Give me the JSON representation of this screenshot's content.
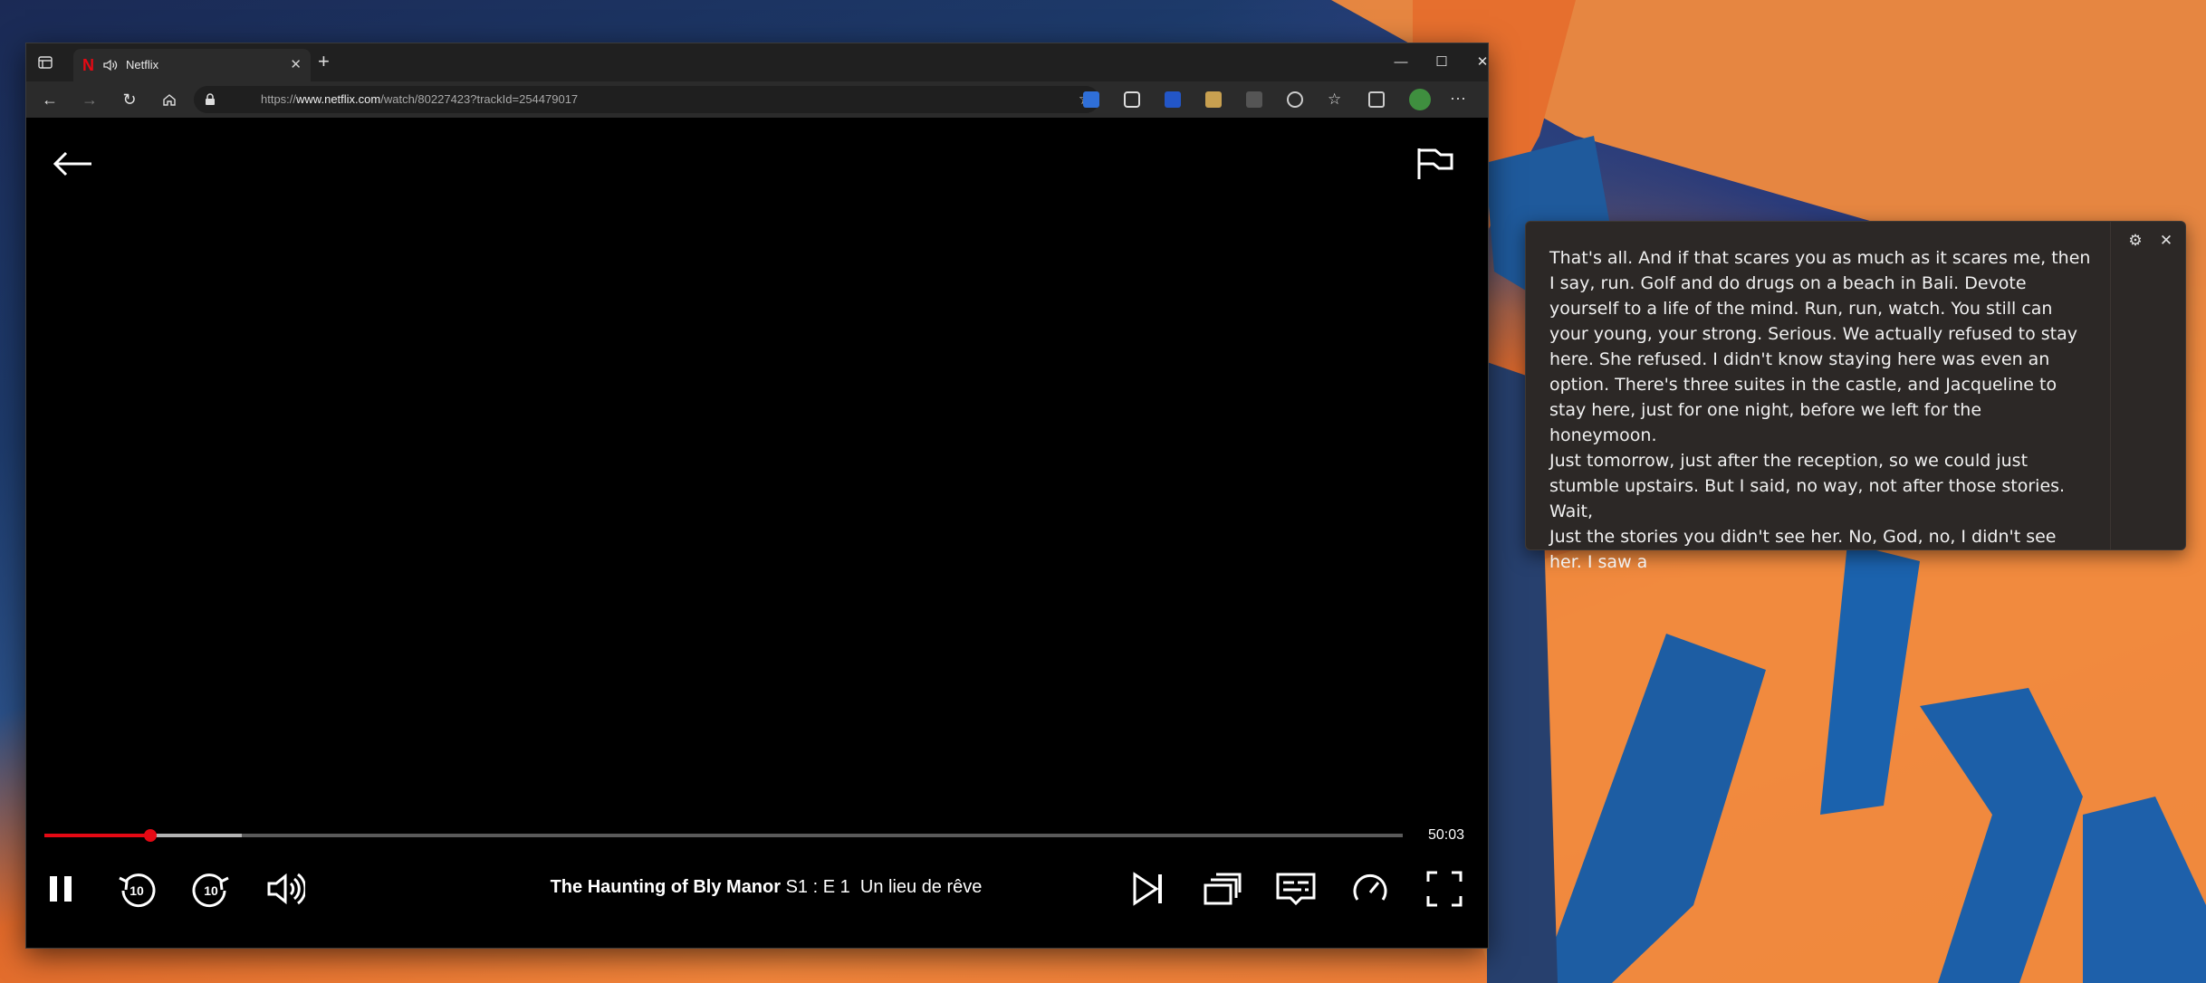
{
  "browser": {
    "tab": {
      "title": "Netflix"
    },
    "address": {
      "url_prefix": "https://",
      "url_host": "www.netflix.com",
      "url_path": "/watch/80227423?trackId=254479017"
    }
  },
  "player": {
    "progress_fraction": 0.078,
    "buffered_fraction": 0.145,
    "time_remaining": "50:03",
    "title": {
      "show": "The Haunting of Bly Manor",
      "episode": "S1 : E 1",
      "episode_title": "Un lieu de rêve"
    },
    "skip_back_label": "10",
    "skip_forward_label": "10"
  },
  "transcript": {
    "paragraphs": [
      "That's all. And if that scares you as much as it scares me, then I say, run. Golf and do drugs on a beach in Bali. Devote yourself to a life of the mind. Run, run, watch. You still can your young, your strong. Serious. We actually refused to stay here. She refused. I didn't know staying here was even an option. There's three suites in the castle, and Jacqueline to stay here, just for one night, before we left for the honeymoon.",
      "Just tomorrow, just after the reception, so we could just stumble upstairs. But I said, no way, not after those stories. Wait,",
      "Just the stories you didn't see her. No, God, no, I didn't see her. I saw a"
    ]
  }
}
